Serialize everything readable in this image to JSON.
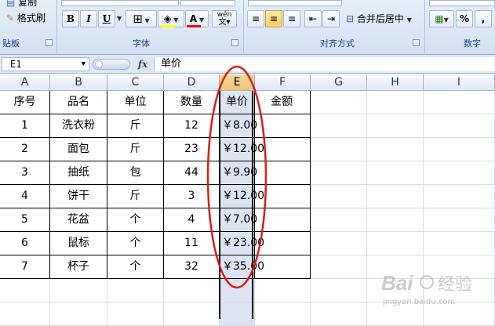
{
  "ribbon": {
    "clipboard": {
      "copy_label": "复制",
      "format_painter_label": "格式刷",
      "group_label": "贴板"
    },
    "font": {
      "group_label": "字体",
      "bold": "B",
      "italic": "I",
      "underline": "U",
      "font_color_letter": "A",
      "phonetic_label": "wén",
      "fill_color": "#ffff00",
      "font_color": "#ff0000"
    },
    "alignment": {
      "group_label": "对齐方式",
      "merge_center_label": "合并后居中"
    },
    "number": {
      "group_label": "数字",
      "percent": "%",
      "comma": ","
    }
  },
  "formula_bar": {
    "name_box": "E1",
    "fx": "fx",
    "content": "单价"
  },
  "columns": [
    "A",
    "B",
    "C",
    "D",
    "E",
    "F",
    "G",
    "H",
    "I"
  ],
  "selected_column": "E",
  "table": {
    "headers": [
      "序号",
      "品名",
      "单位",
      "数量",
      "单价",
      "金额"
    ],
    "rows": [
      [
        "1",
        "洗衣粉",
        "斤",
        "12",
        "￥8.00",
        ""
      ],
      [
        "2",
        "面包",
        "斤",
        "23",
        "￥12.00",
        ""
      ],
      [
        "3",
        "抽纸",
        "包",
        "44",
        "￥9.90",
        ""
      ],
      [
        "4",
        "饼干",
        "斤",
        "3",
        "￥12.00",
        ""
      ],
      [
        "5",
        "花盆",
        "个",
        "4",
        "￥7.00",
        ""
      ],
      [
        "6",
        "鼠标",
        "个",
        "11",
        "￥23.00",
        ""
      ],
      [
        "7",
        "杯子",
        "个",
        "32",
        "￥35.00",
        ""
      ]
    ]
  },
  "watermark": {
    "brand": "Bai",
    "brand_cn": "经验",
    "url": "jingyan.baidu.com"
  },
  "colors": {
    "annotation_ellipse": "#d81e1e",
    "ribbon_bg": "#dce6f4",
    "selected_header": "#f5c977"
  }
}
